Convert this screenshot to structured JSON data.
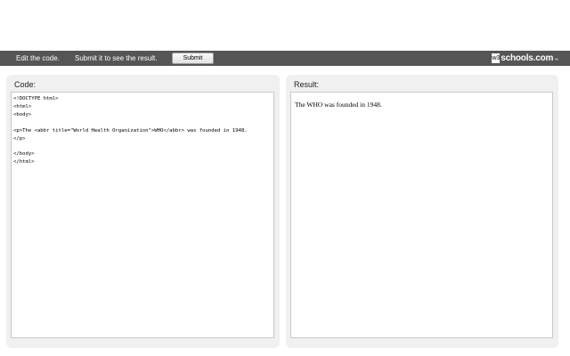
{
  "toolbar": {
    "hint_edit": "Edit the code.",
    "hint_submit": "Submit it to see the result.",
    "submit_label": "Submit",
    "logo": {
      "mark": "w3",
      "text": "schools.com",
      "tm": "™"
    }
  },
  "code_panel": {
    "title": "Code:",
    "lines": [
      "<!DOCTYPE html>",
      "<html>",
      "<body>",
      "",
      "<p>The <abbr title=\"World Health Organization\">WHO</abbr> was founded in 1948.",
      "</p>",
      "",
      "</body>",
      "</html>"
    ]
  },
  "result_panel": {
    "title": "Result:",
    "text": "The WHO was founded in 1948."
  },
  "colors": {
    "toolbar_bg": "#555555",
    "panel_bg": "#f0f0f0",
    "editor_border": "#c9c9c9"
  }
}
